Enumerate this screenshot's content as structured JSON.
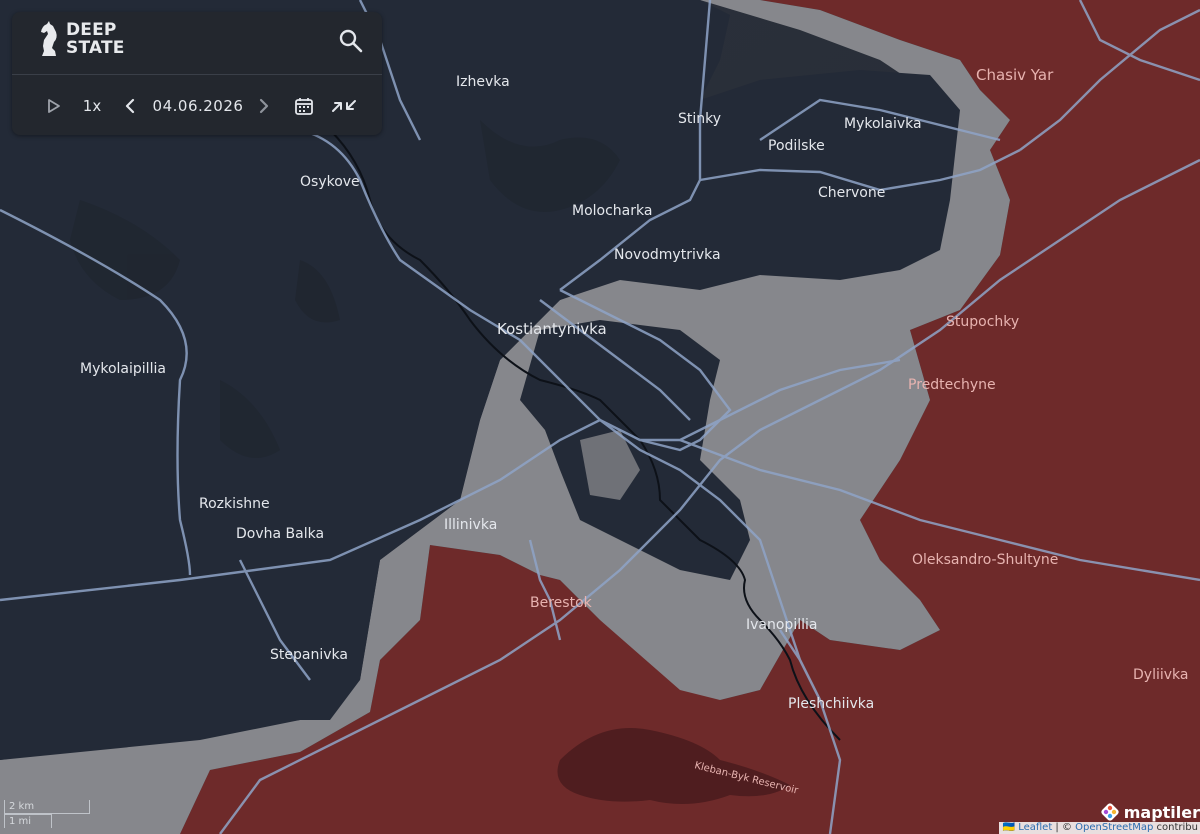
{
  "app": {
    "logo_line1": "DEEP",
    "logo_line2": "STATE"
  },
  "toolbar": {
    "speed": "1x",
    "date": "04.06.2026"
  },
  "colors": {
    "occupied": "#6e2a2a",
    "contested": "#8a8b8f",
    "controlled": "#232936",
    "roads": "#8fa4c7",
    "panel": "#23272e"
  },
  "icons": [
    "logo-knight-icon",
    "search-icon",
    "play-icon",
    "prev-date-icon",
    "next-date-icon",
    "calendar-icon",
    "compare-icon"
  ],
  "places": {
    "izhevka": "Izhevka",
    "stinky": "Stinky",
    "chasiv_yar": "Chasiv Yar",
    "mykolaivka": "Mykolaivka",
    "podilske": "Podilske",
    "osykove": "Osykove",
    "chervone": "Chervone",
    "molocharka": "Molocharka",
    "novodmytrivka": "Novodmytrivka",
    "kostiantynivka": "Kostiantynivka",
    "stupochky": "Stupochky",
    "mykolaipillia": "Mykolaipillia",
    "predtechyne": "Predtechyne",
    "rozkishne": "Rozkishne",
    "dovha_balka": "Dovha Balka",
    "illinivka": "Illinivka",
    "oleksandro_shultyne": "Oleksandro-Shultyne",
    "berestok": "Berestok",
    "ivanopillia": "Ivanopillia",
    "stepanivka": "Stepanivka",
    "dyliivka": "Dyliivka",
    "pleshchiivka": "Pleshchiivka",
    "reservoir": "Kleban-Byk Reservoir"
  },
  "scale": {
    "km": "2 km",
    "mi": "1 mi"
  },
  "attribution": {
    "flag": "🇺🇦",
    "leaflet": "Leaflet",
    "sep": " | © ",
    "osm": "OpenStreetMap",
    "rest": " contribu"
  },
  "maptiler": {
    "brand": "maptiler"
  }
}
